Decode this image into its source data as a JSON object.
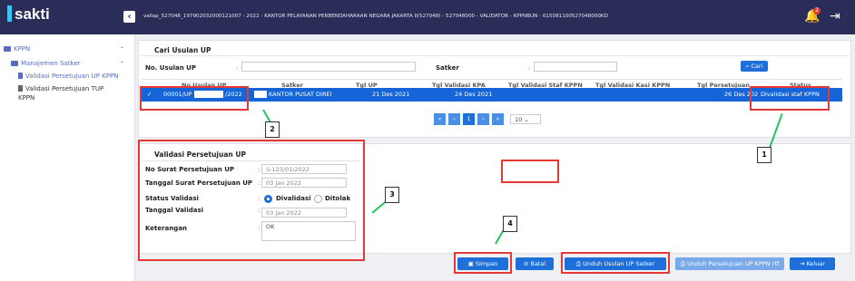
{
  "topbar": {
    "logo": "sakti",
    "collapse_icon": "‹",
    "info": "vallap_527048_197902032000121007 - 2022 - KANTOR PELAYANAN PERBENDAHARAAN NEGARA JAKARTA II(527048) - 527048000 - VALIDATOR - KPPNBUN - 015081100527048000KD",
    "notif_count": "2"
  },
  "sidebar": {
    "root": "KPPN",
    "group": "Manajemen Satker",
    "items": [
      "Validasi Persetujuan UP KPPN",
      "Validasi Persetujuan TUP",
      "KPPN"
    ]
  },
  "search": {
    "title": "Cari Usulan UP",
    "no_label": "No. Usulan UP",
    "satker_label": "Satker",
    "button": "Cari"
  },
  "table": {
    "headers": [
      "No Usulan UP",
      "Satker",
      "Tgl UP",
      "Tgl Validasi KPA",
      "Tgl Validasi Staf KPPN",
      "Tgl Validasi Kasi KPPN",
      "Tgl Persetujuan",
      "Status"
    ],
    "row": {
      "no_prefix": "00001/UP",
      "no_suffix": "/2022",
      "satker": "KANTOR PUSAT DIREI",
      "tgl_up": "21 Des 2021",
      "tgl_kpa": "24 Des 2021",
      "tgl_persetujuan": "26 Des 202",
      "status": "Divalidasi staf KPPN"
    },
    "pagination": {
      "first": "«",
      "prev": "‹",
      "current": "1",
      "next": "›",
      "last": "»",
      "page_size": "10"
    }
  },
  "validasi": {
    "title": "Validasi Persetujuan UP",
    "no_surat_label": "No Surat Persetujuan UP",
    "no_surat_value": "S-123/01/2022",
    "tgl_surat_label": "Tanggal Surat Persetujuan UP",
    "tgl_surat_value": "03 Jan 2022",
    "status_label": "Status Validasi",
    "opt_divalidasi": "Divalidasi",
    "opt_ditolak": "Ditolak",
    "tgl_validasi_label": "Tanggal Validasi",
    "tgl_validasi_value": "03 Jan 2022",
    "keterangan_label": "Keterangan",
    "keterangan_value": "OK"
  },
  "footer": {
    "simpan": "Simpan",
    "batal": "Batal",
    "unduh_usulan": "Unduh Usulan UP Satker",
    "unduh_persetujuan": "Unduh Persetujuan UP KPPN rtf",
    "keluar": "Keluar"
  },
  "callouts": [
    "1",
    "2",
    "3",
    "4"
  ],
  "colors": {
    "primary": "#1e6fd9",
    "topbar": "#2a2d57",
    "highlight": "#e53935",
    "arrow": "#22c55e"
  }
}
